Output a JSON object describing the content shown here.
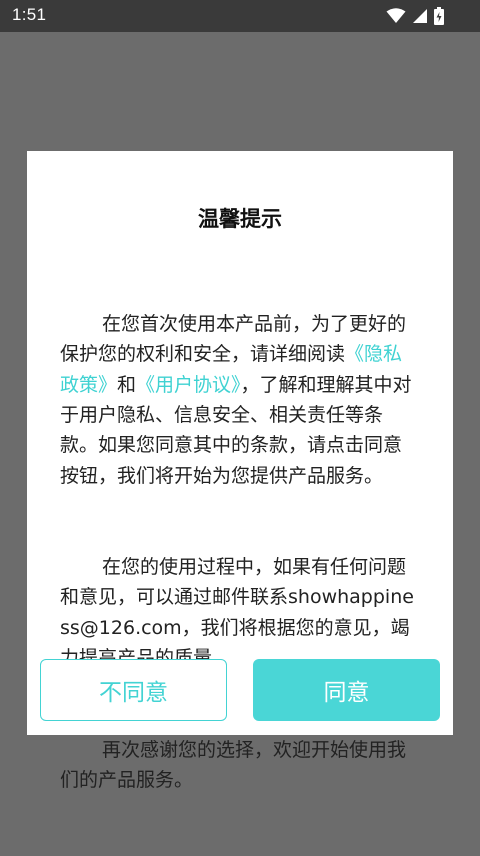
{
  "status_bar": {
    "time": "1:51",
    "icons": [
      "wifi-icon",
      "signal-icon",
      "battery-icon"
    ]
  },
  "dialog": {
    "title": "温馨提示",
    "paragraph1": {
      "text_a": "在您首次使用本产品前，为了更好的保护您的权利和安全，请详细阅读",
      "link_privacy": "《隐私政策》",
      "text_b": "和",
      "link_agreement": "《用户协议》",
      "text_c": "，了解和理解其中对于用户隐私、信息安全、相关责任等条款。如果您同意其中的条款，请点击同意按钮，我们将开始为您提供产品服务。"
    },
    "paragraph2": "在您的使用过程中，如果有任何问题和意见，可以通过邮件联系showhappiness@126.com，我们将根据您的意见，竭力提高产品的质量。",
    "paragraph3": "再次感谢您的选择，欢迎开始使用我们的产品服务。",
    "disagree_label": "不同意",
    "agree_label": "同意"
  },
  "colors": {
    "accent": "#4ad6d6",
    "link": "#3fd2d2",
    "overlay": "#6c6c6c",
    "status_bar": "#3a3a3a"
  }
}
